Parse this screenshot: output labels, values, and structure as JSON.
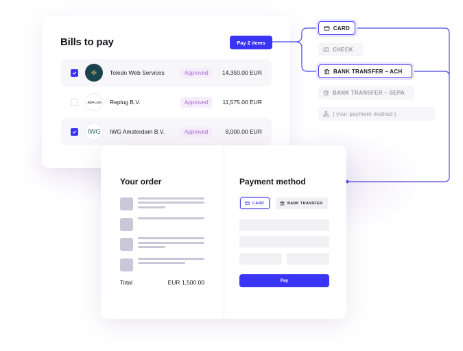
{
  "bills": {
    "title": "Bills to pay",
    "pay_button": "Pay 2 items",
    "rows": [
      {
        "vendor": "Toledo Web Services",
        "logo": "toledo-logo",
        "checked": true,
        "status": "Approved",
        "amount": "14,350.00 EUR"
      },
      {
        "vendor": "Replug B.V.",
        "logo_text": ".REPLUG",
        "checked": false,
        "status": "Approved",
        "amount": "11,575.00 EUR"
      },
      {
        "vendor": "IWG Amsterdam B.V.",
        "logo_text": "IWG",
        "checked": true,
        "status": "Approved",
        "amount": "8,000.00 EUR"
      }
    ]
  },
  "payment_methods": [
    {
      "label": "CARD",
      "icon": "card-icon",
      "active": true
    },
    {
      "label": "CHECK",
      "icon": "check-doc-icon",
      "active": false
    },
    {
      "label": "BANK TRANSFER – ACH",
      "icon": "bank-icon",
      "active": true
    },
    {
      "label": "BANK TRANSFER – SEPA",
      "icon": "bank-icon",
      "active": false
    },
    {
      "label": "{ your-payment-method }",
      "icon": "hierarchy-icon",
      "active": false
    }
  ],
  "checkout": {
    "order_title": "Your order",
    "total_label": "Total",
    "total_value": "EUR 1,500.00",
    "payment_title": "Payment method",
    "tabs": [
      {
        "label": "CARD",
        "icon": "card-icon",
        "selected": true
      },
      {
        "label": "BANK TRANSFER",
        "icon": "bank-icon",
        "selected": false
      }
    ],
    "pay_label": "Pay"
  },
  "colors": {
    "accent": "#3a34f5",
    "connector": "#4a43e8",
    "badge_bg": "#f6ecfc",
    "badge_text": "#a56fd6",
    "placeholder": "#c9c7d8"
  }
}
